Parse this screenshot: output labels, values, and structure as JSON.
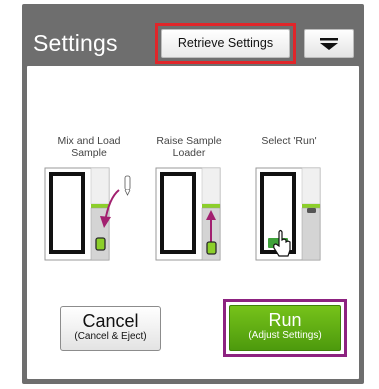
{
  "header": {
    "title": "Settings",
    "retrieve_label": "Retrieve Settings",
    "menu_icon": "dropdown-menu-icon"
  },
  "steps": [
    {
      "label": "Mix and Load Sample",
      "illustration": "mix-load-sample-icon"
    },
    {
      "label": "Raise Sample Loader",
      "illustration": "raise-loader-icon"
    },
    {
      "label": "Select 'Run'",
      "illustration": "select-run-icon"
    }
  ],
  "actions": {
    "cancel_label": "Cancel",
    "cancel_sub": "(Cancel & Eject)",
    "run_label": "Run",
    "run_sub": "(Adjust Settings)"
  },
  "colors": {
    "frame": "#6e6e6e",
    "highlight_red": "#e0262a",
    "highlight_purple": "#8d2280",
    "run_green": "#5fae12",
    "arrow_purple": "#a2206f",
    "loader_green": "#8ccf2a"
  }
}
